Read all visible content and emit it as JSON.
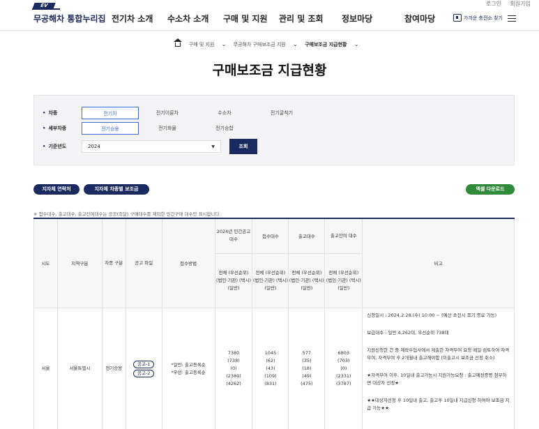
{
  "util": {
    "login": "로그인",
    "join": "회원가입"
  },
  "header": {
    "logo_badge": "EV",
    "logo_text": "무공해차 통합누리집",
    "nav": [
      "전기차 소개",
      "수소차 소개",
      "구매 및 지원",
      "관리 및 조회",
      "정보마당",
      "참여마당"
    ],
    "charger_label": "가까운 충전소 찾기"
  },
  "breadcrumb": [
    "구매 및 지원",
    "무공해차 구매보조금 지원",
    "구매보조금 지급현황"
  ],
  "page_title": "구매보조금 지급현황",
  "search": {
    "vehicle_type": {
      "label": "차종",
      "options": [
        "전기차",
        "전기이륜차",
        "수소차",
        "전기굴착기"
      ],
      "selected": "전기차"
    },
    "sub_type": {
      "label": "세부차종",
      "options": [
        "전기승용",
        "전기화물",
        "전기승합"
      ],
      "selected": "전기승용"
    },
    "year": {
      "label": "기준년도",
      "value": "2024"
    },
    "search_button": "조회"
  },
  "buttons": {
    "contacts": "지자체 연락처",
    "subsidy": "지자체 차종별 보조금",
    "excel": "엑셀 다운로드"
  },
  "note": "※ 접수대수, 출고대수, 출고잔여대수는 공공(조달) 구매대수를 제외한 민간구매 대수만 표시합니다.",
  "table": {
    "headers": {
      "sido": "시도",
      "region": "지역구분",
      "car_type": "차종 구분",
      "notice": "공고 파일",
      "method": "접수방법",
      "notice_count": "2024년 민간공고 대수",
      "received": "접수대수",
      "released": "출고대수",
      "remaining": "출고잔여 대수",
      "breakdown": "전체 (우선순위) (법인·기관) (택시) (일반)",
      "memo": "비고"
    },
    "row": {
      "sido": "서울",
      "region": "서울특별시",
      "car_type": "전기승용",
      "notice_tags": [
        "공고-1",
        "공고-2"
      ],
      "method": [
        "*일반: 출고등록순",
        "*우선: 출고등록순"
      ],
      "notice_count": [
        "7380",
        "(738)",
        "(0)",
        "(2380)",
        "(4262)"
      ],
      "received": [
        "1045",
        "(62)",
        "(43)",
        "(109)",
        "(831)"
      ],
      "released": [
        "577",
        "(35)",
        "(18)",
        "(49)",
        "(475)"
      ],
      "remaining": [
        "6803",
        "(703)",
        "(0)",
        "(2331)",
        "(3787)"
      ],
      "memo": [
        "신청일시 : 2024.2.28.(수) 10:00 ~ (예산 소진시 조기 종료 가능)",
        "보급대수 : 일반 4,262대, 우선순위 738대",
        "지원신청한 건 중 제작수입사에서 제출한 자격부여 요청 메일 검토하여 자격부여, 자격부여 후 2개월내 출고해야함 (미출고시 보조금 선정 취소)",
        "★자격부여 이후, 10일내 출고가능시 지원가능요청 : 출고예정증명 첨부하면 대상자 선정★",
        "★★대상자선정 후 10일내 출고, 출고후 10일내 지급신청 하여야 보조금 지급 가능★★"
      ]
    }
  }
}
